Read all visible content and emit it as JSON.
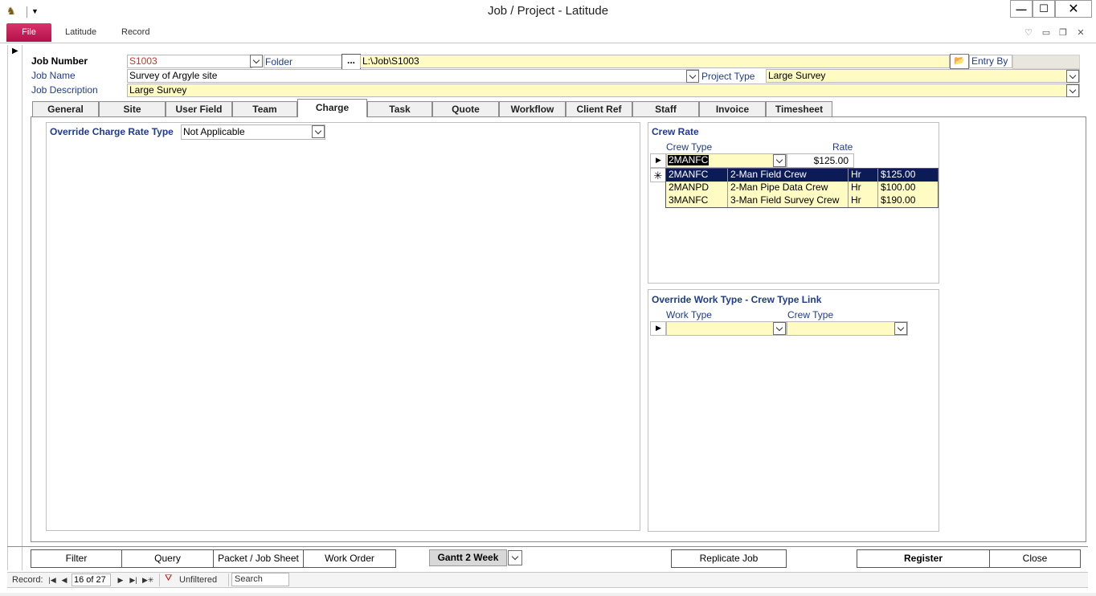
{
  "window": {
    "title": "Job / Project - Latitude",
    "minimize_glyph": "—",
    "maximize_glyph": "☐",
    "close_glyph": "✕"
  },
  "ribbon": {
    "file_label": "File",
    "tabs": [
      "Latitude",
      "Record"
    ]
  },
  "header": {
    "job_number_label": "Job Number",
    "job_number_value": "S1003",
    "folder_label": "Folder",
    "browse_label": "...",
    "folder_value": "L:\\Job\\S1003",
    "entry_by_label": "Entry By",
    "entry_by_value": "",
    "job_name_label": "Job Name",
    "job_name_value": "Survey of Argyle site",
    "project_type_label": "Project Type",
    "project_type_value": "Large Survey",
    "job_description_label": "Job Description",
    "job_description_value": "Large Survey"
  },
  "tabs": [
    "General",
    "Site",
    "User Field",
    "Team",
    "Charge",
    "Task",
    "Quote",
    "Workflow",
    "Client Ref",
    "Staff",
    "Invoice",
    "Timesheet"
  ],
  "active_tab": "Charge",
  "charge": {
    "override_rate_label": "Override Charge Rate Type",
    "override_rate_value": "Not Applicable",
    "crew_rate": {
      "title": "Crew Rate",
      "col_crew_type": "Crew Type",
      "col_rate": "Rate",
      "current_crew_type": "2MANFC",
      "current_rate": "$125.00",
      "new_row_glyph": "✳",
      "dropdown_options": [
        {
          "code": "2MANFC",
          "name": "2-Man Field Crew",
          "unit": "Hr",
          "rate": "$125.00"
        },
        {
          "code": "2MANPD",
          "name": "2-Man Pipe Data Crew",
          "unit": "Hr",
          "rate": "$100.00"
        },
        {
          "code": "3MANFC",
          "name": "3-Man Field Survey Crew",
          "unit": "Hr",
          "rate": "$190.00"
        }
      ]
    },
    "override_work_type": {
      "title": "Override Work Type - Crew Type Link",
      "col_work_type": "Work Type",
      "col_crew_type": "Crew Type",
      "work_type_value": "",
      "crew_type_value": ""
    }
  },
  "footer": {
    "filter": "Filter",
    "query": "Query",
    "packet": "Packet / Job Sheet",
    "work_order": "Work Order",
    "gantt": "Gantt 2 Week",
    "replicate": "Replicate Job",
    "register": "Register",
    "close": "Close"
  },
  "navigation": {
    "record_label": "Record:",
    "position": "16 of 27",
    "filter_status": "Unfiltered",
    "search_placeholder": "Search"
  },
  "colors": {
    "file_tab": "#c41a57",
    "field_highlight": "#fffbc2",
    "label_blue": "#1f3b8e",
    "job_number_red": "#c0392b",
    "dropdown_selected": "#0b1b55"
  },
  "icons": {
    "app": "app-logo-icon",
    "folder_open": "folder-open-icon",
    "filter": "filter-off-icon"
  }
}
